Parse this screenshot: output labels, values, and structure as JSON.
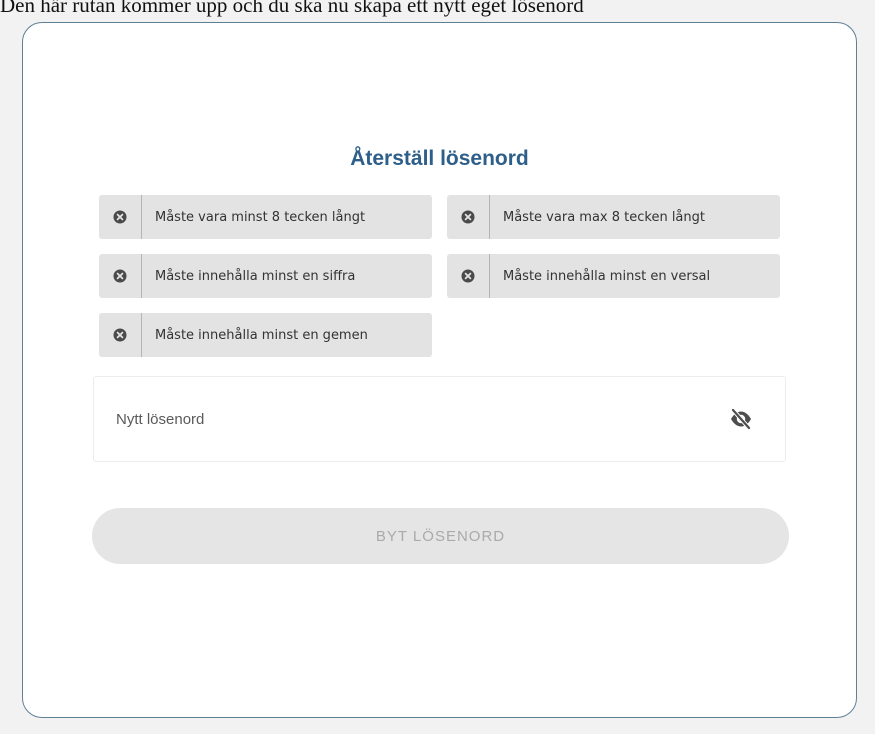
{
  "intro_text": "Den här rutan kommer upp och du ska nu skapa ett nytt eget lösenord",
  "form": {
    "title": "Återställ lösenord",
    "requirements": [
      {
        "label": "Måste vara minst 8 tecken långt"
      },
      {
        "label": "Måste vara max 8 tecken långt"
      },
      {
        "label": "Måste innehålla minst en siffra"
      },
      {
        "label": "Måste innehålla minst en versal"
      },
      {
        "label": "Måste innehålla minst en gemen"
      }
    ],
    "password_placeholder": "Nytt lösenord",
    "password_value": "",
    "submit_label": "BYT LÖSENORD"
  },
  "icons": {
    "requirement": "x-circle-icon",
    "visibility": "eye-slash-icon"
  },
  "colors": {
    "title": "#2e5f8a",
    "card_border": "#5f7f96",
    "requirement_bg": "#e3e3e3",
    "button_disabled_bg": "#e5e5e5",
    "button_disabled_text": "#aaaaaa"
  }
}
